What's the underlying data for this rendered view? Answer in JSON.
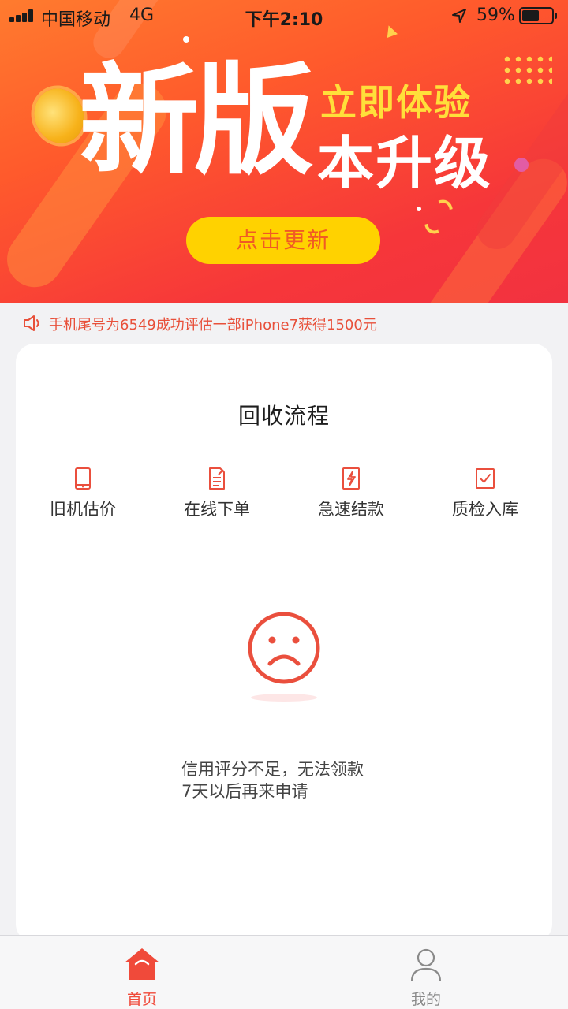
{
  "status_bar": {
    "carrier": "中国移动",
    "network": "4G",
    "time": "下午2:10",
    "battery_percent": "59%",
    "battery_level": 0.59
  },
  "banner": {
    "headline_big": "新版",
    "headline_small_1": "立即体验",
    "headline_small_2": "本升级",
    "update_button": "点击更新",
    "colors": {
      "accent_yellow": "#ffd200",
      "button_text": "#f15a24"
    }
  },
  "notice": {
    "icon": "speaker-icon",
    "text": "手机尾号为6549成功评估一部iPhone7获得1500元"
  },
  "card": {
    "title": "回收流程",
    "steps": [
      {
        "icon": "phone-icon",
        "label": "旧机估价"
      },
      {
        "icon": "order-form-icon",
        "label": "在线下单"
      },
      {
        "icon": "lightning-icon",
        "label": "急速结款"
      },
      {
        "icon": "checkbox-icon",
        "label": "质检入库"
      }
    ],
    "status_icon": "sad-face-icon",
    "message_line_1": "信用评分不足，无法领款",
    "message_line_2": "7天以后再来申请"
  },
  "tabbar": {
    "tabs": [
      {
        "icon": "home-icon",
        "label": "首页",
        "active": true
      },
      {
        "icon": "user-icon",
        "label": "我的",
        "active": false
      }
    ],
    "colors": {
      "active": "#f04a3a",
      "inactive": "#8a8a8a"
    }
  }
}
